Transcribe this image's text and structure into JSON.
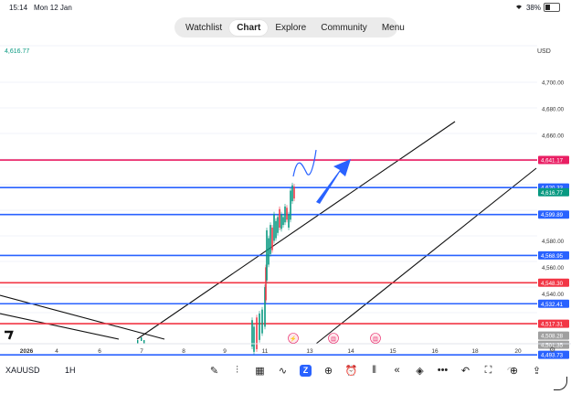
{
  "status": {
    "time": "15:14",
    "date": "Mon 12 Jan",
    "battery_text": "38%",
    "battery_level": 0.38
  },
  "nav": {
    "items": [
      "Watchlist",
      "Chart",
      "Explore",
      "Community",
      "Menu"
    ],
    "active": "Chart"
  },
  "chart": {
    "top_left_price": "4,616.77",
    "currency": "USD",
    "price_axis": [
      "4,700.00",
      "4,680.00",
      "4,660.00",
      "4,580.00",
      "4,560.00",
      "4,540.00"
    ],
    "date_axis": [
      "2026",
      "4",
      "6",
      "7",
      "8",
      "9",
      "11",
      "13",
      "14",
      "15",
      "16",
      "18",
      "20"
    ],
    "hlines": [
      {
        "label": "4,641.17",
        "color": "#e91e63"
      },
      {
        "label": "4,620.33",
        "color": "#2962ff"
      },
      {
        "label": "4,616.77",
        "color": "#089981"
      },
      {
        "label": "4,599.89",
        "color": "#2962ff"
      },
      {
        "label": "4,568.95",
        "color": "#2962ff"
      },
      {
        "label": "4,548.30",
        "color": "#f23645"
      },
      {
        "label": "4,532.41",
        "color": "#2962ff"
      },
      {
        "label": "4,517.31",
        "color": "#f23645"
      },
      {
        "label": "4,508.28",
        "color": "#a0a0a0"
      },
      {
        "label": "4,501.35",
        "color": "#a0a0a0"
      },
      {
        "label": "4,493.73",
        "color": "#2962ff"
      }
    ]
  },
  "footer": {
    "symbol": "XAUUSD",
    "timeframe": "1H",
    "tools": [
      "pencil-icon",
      "chart-type-icon",
      "grid-icon",
      "indicator-icon",
      "alert-logo-icon",
      "plus-circle-icon",
      "alarm-icon",
      "replay-icon",
      "rewind-icon",
      "layers-icon",
      "more-icon",
      "undo-icon",
      "fullscreen-icon",
      "redo-icon"
    ],
    "right_tools": [
      "add-circle-icon",
      "share-icon"
    ]
  }
}
